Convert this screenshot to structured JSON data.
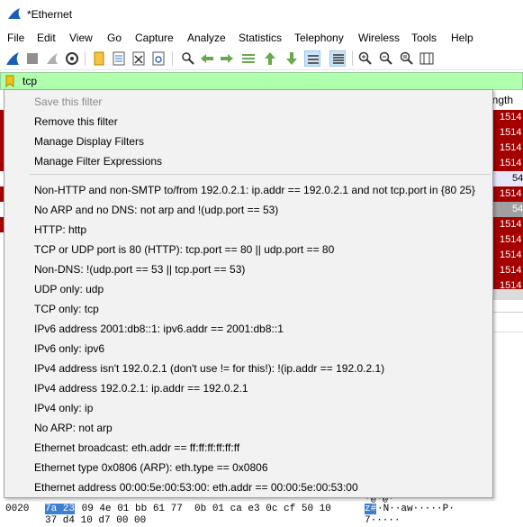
{
  "window": {
    "title": "*Ethernet"
  },
  "menubar": [
    "File",
    "Edit",
    "View",
    "Go",
    "Capture",
    "Analyze",
    "Statistics",
    "Telephony",
    "Wireless",
    "Tools",
    "Help"
  ],
  "toolbar": {
    "icons": [
      "shark-fin-start-icon",
      "stop-icon",
      "restart-icon",
      "capture-options-icon",
      "open-file-icon",
      "save-file-icon",
      "close-file-icon",
      "reload-icon",
      "find-packet-icon",
      "back-arrow-icon",
      "forward-arrow-icon",
      "go-to-packet-icon",
      "first-packet-icon",
      "last-packet-icon",
      "autoscroll-icon",
      "colorize-icon",
      "zoom-in-icon",
      "zoom-out-icon",
      "normal-size-icon",
      "resize-columns-icon"
    ]
  },
  "filter": {
    "value": "tcp"
  },
  "packet_list": {
    "length_header": "ength",
    "rows": [
      {
        "value": "1514",
        "style": "red"
      },
      {
        "value": "1514",
        "style": "red"
      },
      {
        "value": "1514",
        "style": "red"
      },
      {
        "value": "1514",
        "style": "red"
      },
      {
        "value": "54",
        "style": "blue"
      },
      {
        "value": "1514",
        "style": "red"
      },
      {
        "value": "54",
        "style": "gray"
      },
      {
        "value": "1514",
        "style": "red"
      },
      {
        "value": "1514",
        "style": "red"
      },
      {
        "value": "1514",
        "style": "red"
      },
      {
        "value": "1514",
        "style": "red"
      },
      {
        "value": "1514",
        "style": "red"
      }
    ]
  },
  "bytes": {
    "line1_partial": "z#·N··aw·····P·",
    "line2_offset": "0020",
    "line2_hl": "7a 23",
    "line2_rest": " 09 4e 01 bb 61 77  0b 01 ca e3 0c cf 50 10",
    "line2_ascii": "z#",
    "line2_ascii_rest": "·N··aw·····P·",
    "line3": "37 d4 10 d7 00 00",
    "line3_ascii": "7·····",
    "top_ascii": "·@·@·"
  },
  "filter_menu": {
    "items": [
      {
        "label": "Save this filter",
        "disabled": true
      },
      {
        "label": "Remove this filter",
        "disabled": false
      },
      {
        "label": "Manage Display Filters",
        "disabled": false
      },
      {
        "label": "Manage Filter Expressions",
        "disabled": false
      }
    ],
    "saved_filters": [
      "Non-HTTP and non-SMTP to/from 192.0.2.1: ip.addr == 192.0.2.1 and not tcp.port in {80 25}",
      "No ARP and no DNS: not arp and !(udp.port == 53)",
      "HTTP: http",
      "TCP or UDP port is 80 (HTTP): tcp.port == 80 || udp.port == 80",
      "Non-DNS: !(udp.port == 53 || tcp.port == 53)",
      "UDP only: udp",
      "TCP only: tcp",
      "IPv6 address 2001:db8::1: ipv6.addr == 2001:db8::1",
      "IPv6 only: ipv6",
      "IPv4 address isn't 192.0.2.1 (don't use != for this!): !(ip.addr == 192.0.2.1)",
      "IPv4 address 192.0.2.1: ip.addr == 192.0.2.1",
      "IPv4 only: ip",
      "No ARP: not arp",
      "Ethernet broadcast: eth.addr == ff:ff:ff:ff:ff:ff",
      "Ethernet type 0x0806 (ARP): eth.type == 0x0806",
      "Ethernet address 00:00:5e:00:53:00: eth.addr == 00:00:5e:00:53:00"
    ]
  }
}
